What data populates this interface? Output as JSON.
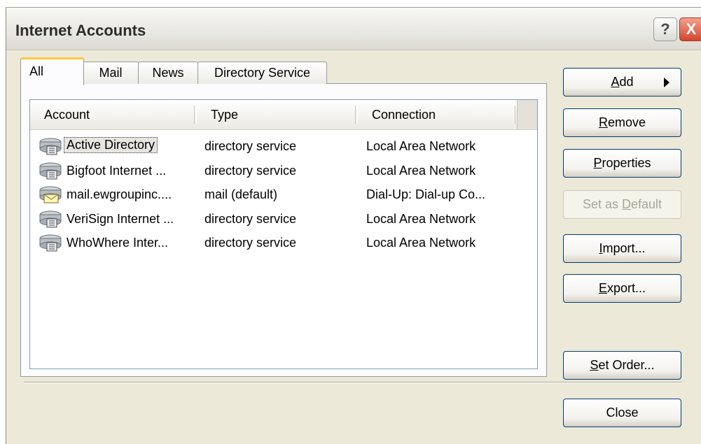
{
  "window": {
    "title": "Internet Accounts"
  },
  "titlebar_buttons": {
    "help": "?",
    "close": "X"
  },
  "tabs": [
    {
      "label": "All",
      "active": true
    },
    {
      "label": "Mail",
      "active": false
    },
    {
      "label": "News",
      "active": false
    },
    {
      "label": "Directory Service",
      "active": false
    }
  ],
  "list": {
    "columns": [
      "Account",
      "Type",
      "Connection"
    ],
    "rows": [
      {
        "account": "Active Directory",
        "type": "directory service",
        "connection": "Local Area Network",
        "icon": "directory-service-icon",
        "selected": true
      },
      {
        "account": "Bigfoot Internet ...",
        "type": "directory service",
        "connection": "Local Area Network",
        "icon": "directory-service-icon",
        "selected": false
      },
      {
        "account": "mail.ewgroupinc....",
        "type": "mail (default)",
        "connection": "Dial-Up: Dial-up Co...",
        "icon": "mail-account-icon",
        "selected": false
      },
      {
        "account": "VeriSign Internet ...",
        "type": "directory service",
        "connection": "Local Area Network",
        "icon": "directory-service-icon",
        "selected": false
      },
      {
        "account": "WhoWhere Inter...",
        "type": "directory service",
        "connection": "Local Area Network",
        "icon": "directory-service-icon",
        "selected": false
      }
    ]
  },
  "buttons": {
    "add": {
      "pre": "",
      "u": "A",
      "post": "dd"
    },
    "remove": {
      "pre": "",
      "u": "R",
      "post": "emove"
    },
    "properties": {
      "pre": "",
      "u": "P",
      "post": "roperties"
    },
    "set_default": {
      "pre": "Set as ",
      "u": "D",
      "post": "efault",
      "enabled": false
    },
    "import": {
      "pre": "",
      "u": "I",
      "post": "mport..."
    },
    "export": {
      "pre": "",
      "u": "E",
      "post": "xport..."
    },
    "set_order": {
      "pre": "",
      "u": "S",
      "post": "et Order..."
    },
    "close": {
      "pre": "",
      "u": "",
      "post": "Close"
    }
  }
}
